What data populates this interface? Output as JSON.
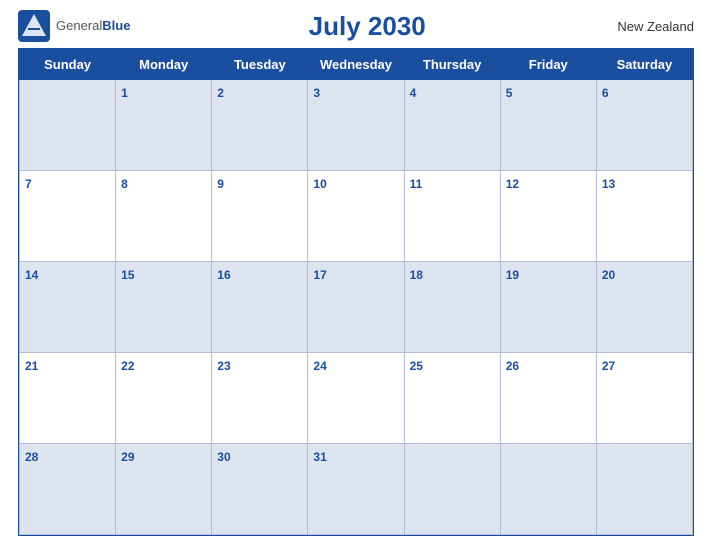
{
  "header": {
    "logo_general": "General",
    "logo_blue": "Blue",
    "title": "July 2030",
    "country": "New Zealand"
  },
  "days_of_week": [
    "Sunday",
    "Monday",
    "Tuesday",
    "Wednesday",
    "Thursday",
    "Friday",
    "Saturday"
  ],
  "weeks": [
    [
      "",
      "1",
      "2",
      "3",
      "4",
      "5",
      "6"
    ],
    [
      "7",
      "8",
      "9",
      "10",
      "11",
      "12",
      "13"
    ],
    [
      "14",
      "15",
      "16",
      "17",
      "18",
      "19",
      "20"
    ],
    [
      "21",
      "22",
      "23",
      "24",
      "25",
      "26",
      "27"
    ],
    [
      "28",
      "29",
      "30",
      "31",
      "",
      "",
      ""
    ]
  ]
}
